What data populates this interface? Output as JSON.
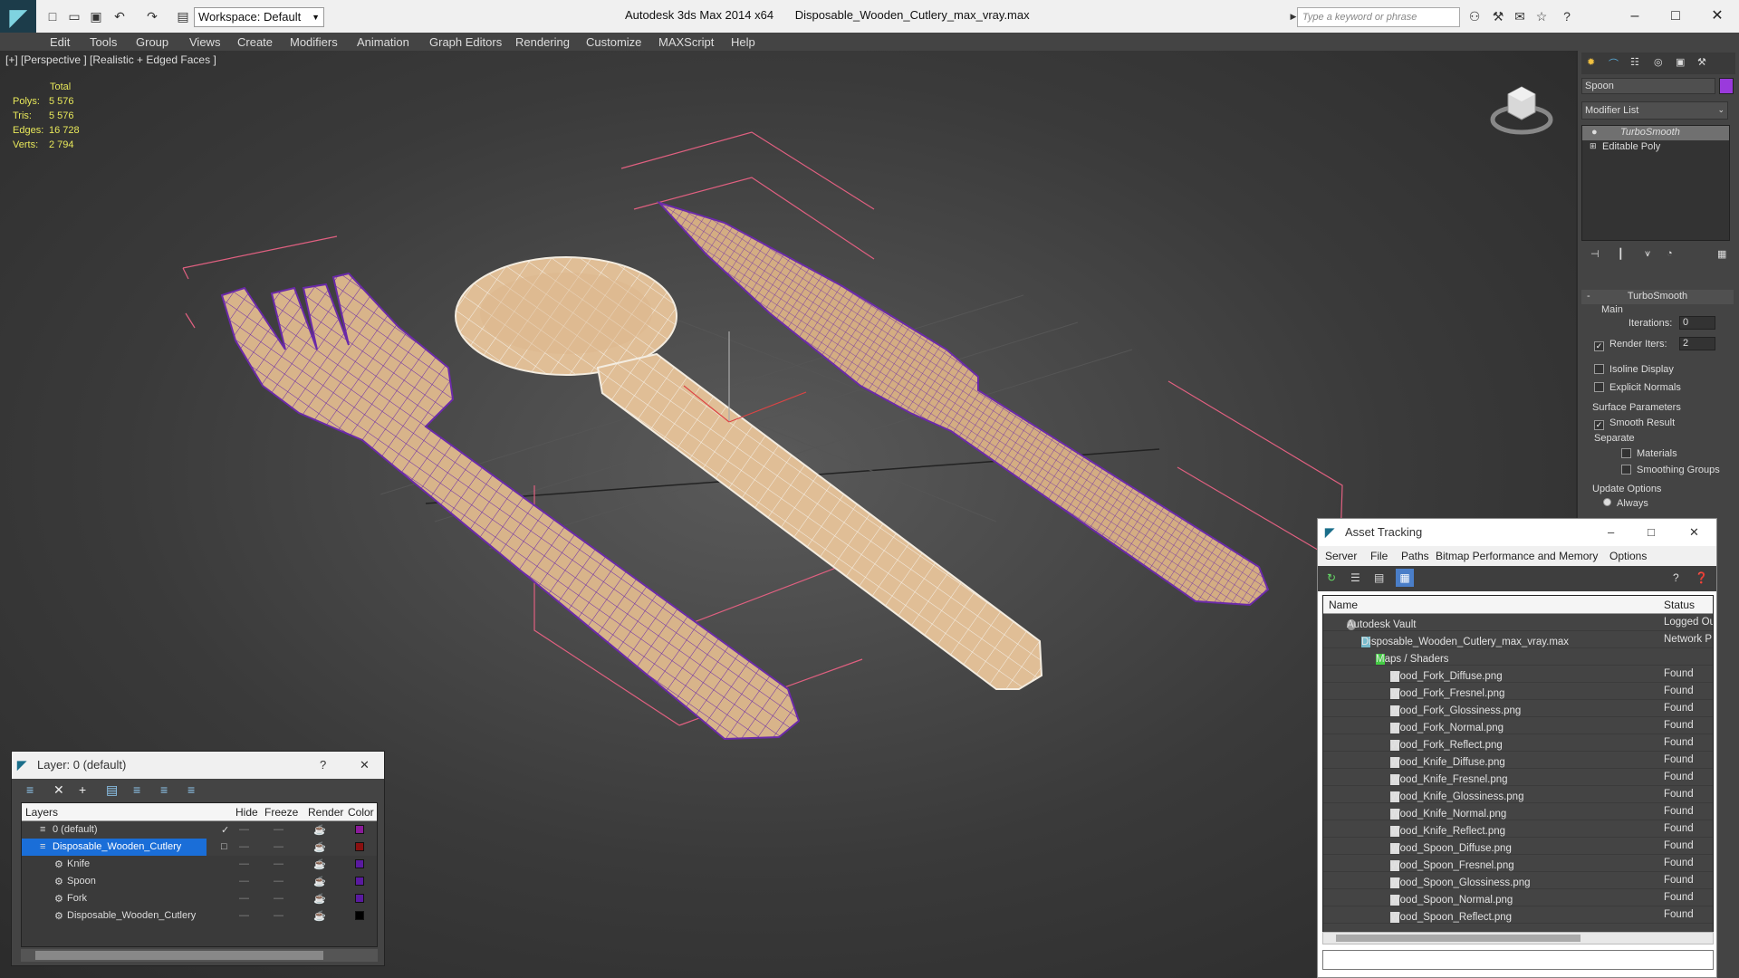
{
  "app": {
    "product": "Autodesk 3ds Max  2014 x64",
    "file": "Disposable_Wooden_Cutlery_max_vray.max",
    "workspace": "Workspace: Default",
    "search_placeholder": "Type a keyword or phrase"
  },
  "menu": [
    "Edit",
    "Tools",
    "Group",
    "Views",
    "Create",
    "Modifiers",
    "Animation",
    "Graph Editors",
    "Rendering",
    "Customize",
    "MAXScript",
    "Help"
  ],
  "viewport": {
    "label": "[+] [Perspective ] [Realistic + Edged Faces ]",
    "stats": {
      "header": "Total",
      "rows": [
        {
          "label": "Polys:",
          "value": "5 576"
        },
        {
          "label": "Tris:",
          "value": "5 576"
        },
        {
          "label": "Edges:",
          "value": "16 728"
        },
        {
          "label": "Verts:",
          "value": "2 794"
        }
      ]
    }
  },
  "command_panel": {
    "object_name": "Spoon",
    "modifier_list": "Modifier List",
    "stack": [
      "TurboSmooth",
      "Editable Poly"
    ],
    "rollout_title": "TurboSmooth",
    "main_label": "Main",
    "iterations_label": "Iterations:",
    "iterations_value": "0",
    "render_iters_label": "Render Iters:",
    "render_iters_value": "2",
    "isoline": "Isoline Display",
    "explicit_normals": "Explicit Normals",
    "surface_params": "Surface Parameters",
    "smooth_result": "Smooth Result",
    "separate": "Separate",
    "materials": "Materials",
    "smoothing_groups": "Smoothing Groups",
    "update_options": "Update Options",
    "always": "Always"
  },
  "layer_window": {
    "title": "Layer: 0 (default)",
    "columns": [
      "Layers",
      "Hide",
      "Freeze",
      "Render",
      "Color"
    ],
    "rows": [
      {
        "name": "0 (default)",
        "color": "#8a1a9a",
        "indent": 1
      },
      {
        "name": "Disposable_Wooden_Cutlery",
        "color": "#8a1010",
        "indent": 1
      },
      {
        "name": "Knife",
        "color": "#5a1aa0",
        "indent": 2
      },
      {
        "name": "Spoon",
        "color": "#5a1aa0",
        "indent": 2
      },
      {
        "name": "Fork",
        "color": "#5a1aa0",
        "indent": 2
      },
      {
        "name": "Disposable_Wooden_Cutlery",
        "color": "#000000",
        "indent": 2
      }
    ]
  },
  "asset_window": {
    "title": "Asset Tracking",
    "menu": [
      "Server",
      "File",
      "Paths",
      "Bitmap Performance and Memory",
      "Options"
    ],
    "columns": [
      "Name",
      "Status"
    ],
    "rows": [
      {
        "name": "Autodesk Vault",
        "status": "Logged Ou",
        "indent": 1
      },
      {
        "name": "Disposable_Wooden_Cutlery_max_vray.max",
        "status": "Network P",
        "indent": 2
      },
      {
        "name": "Maps / Shaders",
        "status": "",
        "indent": 3
      },
      {
        "name": "Wood_Fork_Diffuse.png",
        "status": "Found",
        "indent": 4
      },
      {
        "name": "Wood_Fork_Fresnel.png",
        "status": "Found",
        "indent": 4
      },
      {
        "name": "Wood_Fork_Glossiness.png",
        "status": "Found",
        "indent": 4
      },
      {
        "name": "Wood_Fork_Normal.png",
        "status": "Found",
        "indent": 4
      },
      {
        "name": "Wood_Fork_Reflect.png",
        "status": "Found",
        "indent": 4
      },
      {
        "name": "Wood_Knife_Diffuse.png",
        "status": "Found",
        "indent": 4
      },
      {
        "name": "Wood_Knife_Fresnel.png",
        "status": "Found",
        "indent": 4
      },
      {
        "name": "Wood_Knife_Glossiness.png",
        "status": "Found",
        "indent": 4
      },
      {
        "name": "Wood_Knife_Normal.png",
        "status": "Found",
        "indent": 4
      },
      {
        "name": "Wood_Knife_Reflect.png",
        "status": "Found",
        "indent": 4
      },
      {
        "name": "Wood_Spoon_Diffuse.png",
        "status": "Found",
        "indent": 4
      },
      {
        "name": "Wood_Spoon_Fresnel.png",
        "status": "Found",
        "indent": 4
      },
      {
        "name": "Wood_Spoon_Glossiness.png",
        "status": "Found",
        "indent": 4
      },
      {
        "name": "Wood_Spoon_Normal.png",
        "status": "Found",
        "indent": 4
      },
      {
        "name": "Wood_Spoon_Reflect.png",
        "status": "Found",
        "indent": 4
      }
    ]
  }
}
